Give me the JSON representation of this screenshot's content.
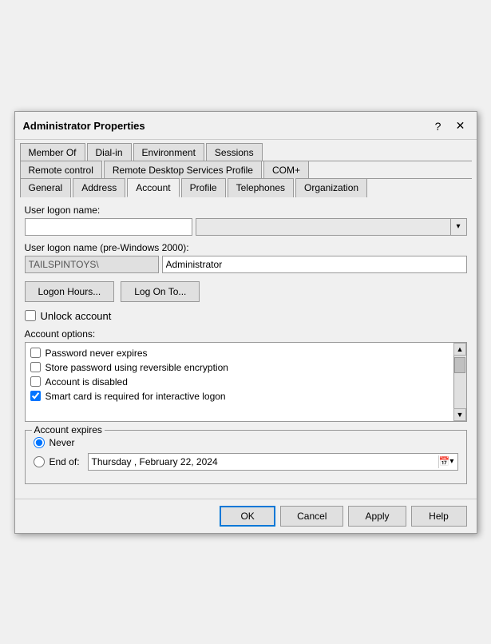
{
  "dialog": {
    "title": "Administrator Properties",
    "help_icon": "?",
    "close_icon": "✕"
  },
  "tabs": {
    "row1": [
      {
        "label": "Member Of",
        "active": false
      },
      {
        "label": "Dial-in",
        "active": false
      },
      {
        "label": "Environment",
        "active": false
      },
      {
        "label": "Sessions",
        "active": false
      }
    ],
    "row2": [
      {
        "label": "Remote control",
        "active": false
      },
      {
        "label": "Remote Desktop Services Profile",
        "active": false
      },
      {
        "label": "COM+",
        "active": false
      }
    ],
    "row3": [
      {
        "label": "General",
        "active": false
      },
      {
        "label": "Address",
        "active": false
      },
      {
        "label": "Account",
        "active": true
      },
      {
        "label": "Profile",
        "active": false
      },
      {
        "label": "Telephones",
        "active": false
      },
      {
        "label": "Organization",
        "active": false
      }
    ]
  },
  "form": {
    "logon_name_label": "User logon name:",
    "logon_name_value": "",
    "logon_name_domain": "",
    "pre2000_label": "User logon name (pre-Windows 2000):",
    "pre2000_domain": "TAILSPINTOYS\\",
    "pre2000_name": "Administrator",
    "logon_hours_btn": "Logon Hours...",
    "log_on_to_btn": "Log On To...",
    "unlock_label": "Unlock account",
    "account_options_label": "Account options:",
    "options": [
      {
        "label": "Password never expires",
        "checked": false
      },
      {
        "label": "Store password using reversible encryption",
        "checked": false
      },
      {
        "label": "Account is disabled",
        "checked": false
      },
      {
        "label": "Smart card is required for interactive logon",
        "checked": true
      }
    ],
    "account_expires_label": "Account expires",
    "never_label": "Never",
    "end_of_label": "End of:",
    "date_value": "Thursday ,   February  22, 2024",
    "never_selected": true,
    "end_of_selected": false
  },
  "footer": {
    "ok": "OK",
    "cancel": "Cancel",
    "apply": "Apply",
    "help": "Help"
  }
}
